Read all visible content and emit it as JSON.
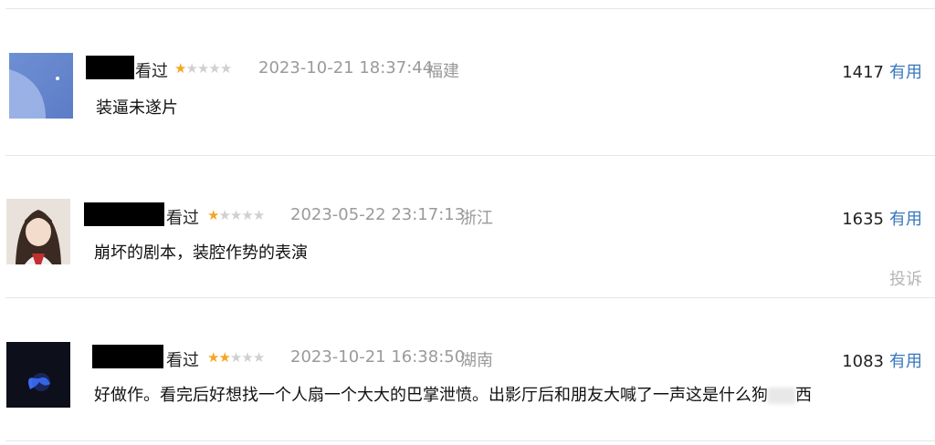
{
  "reviews": [
    {
      "status": "看过",
      "rating": 1,
      "rating_max": 5,
      "datetime": "2023-10-21 18:37:44",
      "location": "福建",
      "likes": "1417",
      "useful_label": "有用",
      "comment": "装逼未遂片",
      "avatar_icon": "moon-sky-avatar"
    },
    {
      "status": "看过",
      "rating": 1,
      "rating_max": 5,
      "datetime": "2023-05-22 23:17:13",
      "location": "浙江",
      "likes": "1635",
      "useful_label": "有用",
      "comment": "崩坏的剧本，装腔作势的表演",
      "report_label": "投诉",
      "avatar_icon": "girl-portrait-avatar"
    },
    {
      "status": "看过",
      "rating": 2,
      "rating_max": 5,
      "datetime": "2023-10-21 16:38:50",
      "location": "湖南",
      "likes": "1083",
      "useful_label": "有用",
      "comment_before": "好做作。看完后好想找一个人扇一个大大的巴掌泄愤。出影厅后和朋友大喊了一声这是什么狗",
      "comment_after": "西",
      "avatar_icon": "dark-butterfly-avatar"
    }
  ],
  "colors": {
    "star_on": "#f5a623",
    "star_off": "#d0d0d0",
    "useful": "#3777bc",
    "meta": "#9a9a9a"
  }
}
